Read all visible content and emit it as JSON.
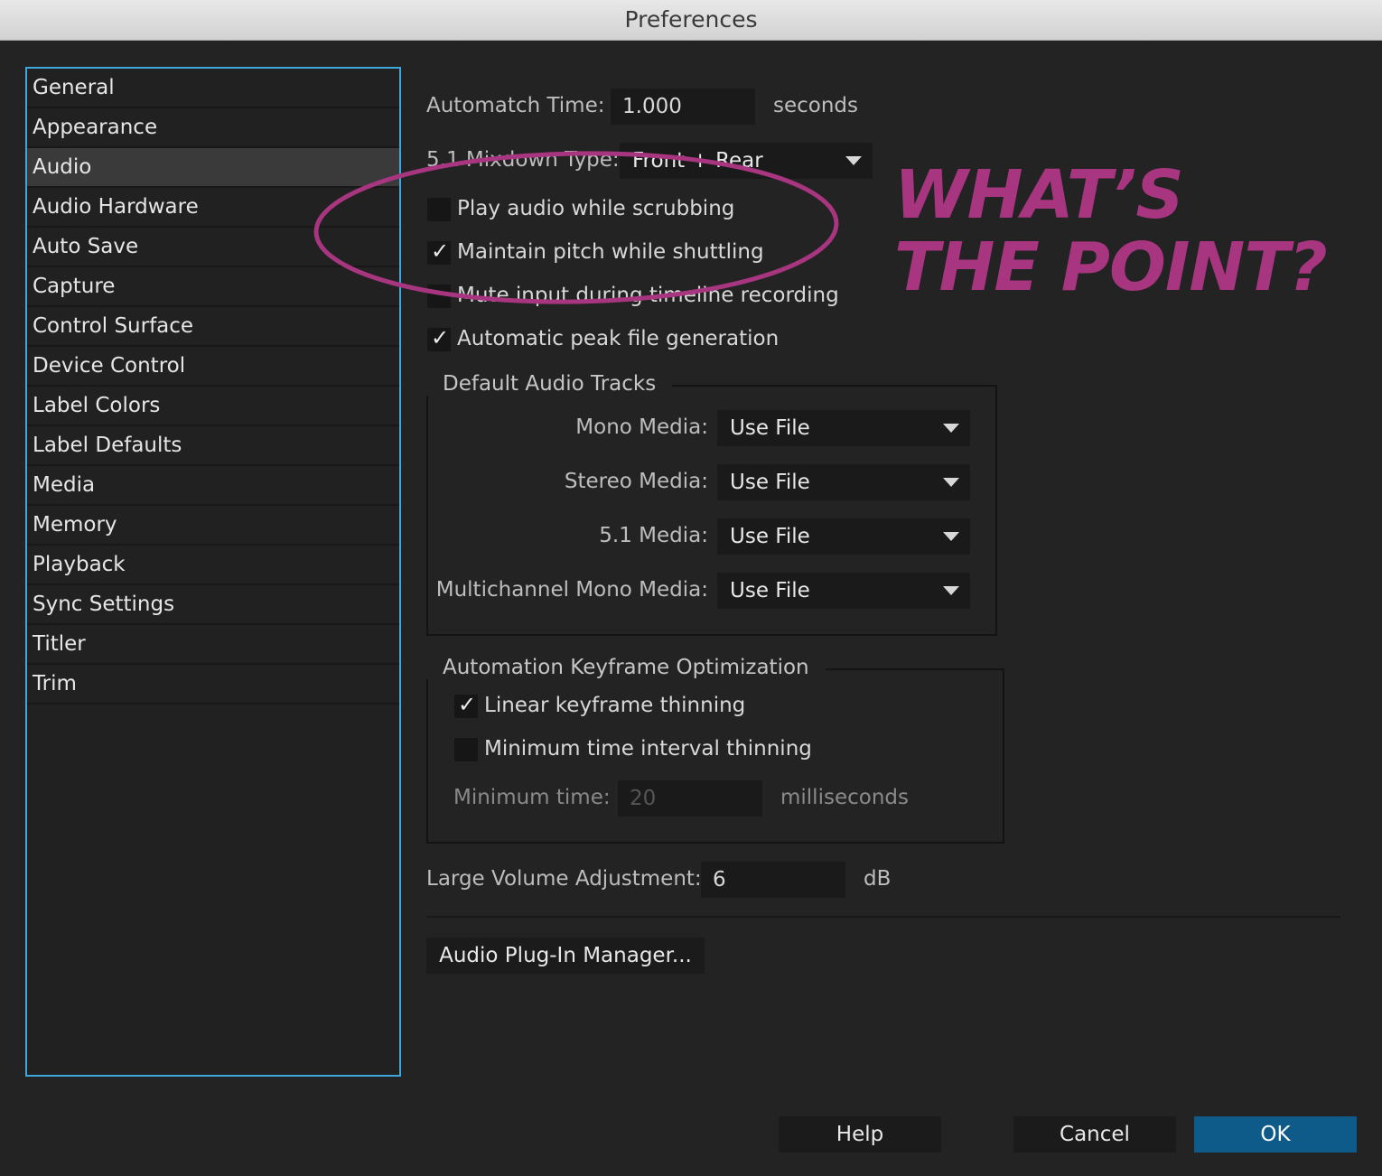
{
  "window": {
    "title": "Preferences"
  },
  "sidebar": {
    "items": [
      {
        "label": "General"
      },
      {
        "label": "Appearance"
      },
      {
        "label": "Audio"
      },
      {
        "label": "Audio Hardware"
      },
      {
        "label": "Auto Save"
      },
      {
        "label": "Capture"
      },
      {
        "label": "Control Surface"
      },
      {
        "label": "Device Control"
      },
      {
        "label": "Label Colors"
      },
      {
        "label": "Label Defaults"
      },
      {
        "label": "Media"
      },
      {
        "label": "Memory"
      },
      {
        "label": "Playback"
      },
      {
        "label": "Sync Settings"
      },
      {
        "label": "Titler"
      },
      {
        "label": "Trim"
      }
    ],
    "selected": "Audio"
  },
  "audio": {
    "automatch_label": "Automatch Time:",
    "automatch_value": "1.000",
    "automatch_unit": "seconds",
    "mixdown_label": "5.1 Mixdown Type:",
    "mixdown_value": "Front + Rear",
    "play_scrub_label": "Play audio while scrubbing",
    "play_scrub_checked": false,
    "maintain_pitch_label": "Maintain pitch while shuttling",
    "maintain_pitch_checked": true,
    "mute_input_label": "Mute input during timeline recording",
    "mute_input_checked": false,
    "auto_peak_label": "Automatic peak file generation",
    "auto_peak_checked": true
  },
  "default_tracks": {
    "legend": "Default Audio Tracks",
    "rows": [
      {
        "label": "Mono Media:",
        "value": "Use File"
      },
      {
        "label": "Stereo Media:",
        "value": "Use File"
      },
      {
        "label": "5.1 Media:",
        "value": "Use File"
      },
      {
        "label": "Multichannel Mono Media:",
        "value": "Use File"
      }
    ]
  },
  "keyframe_opt": {
    "legend": "Automation Keyframe Optimization",
    "linear_label": "Linear keyframe thinning",
    "linear_checked": true,
    "min_interval_label": "Minimum time interval thinning",
    "min_interval_checked": false,
    "min_time_label": "Minimum time:",
    "min_time_value": "20",
    "min_time_unit": "milliseconds"
  },
  "volume": {
    "label": "Large Volume Adjustment:",
    "value": "6",
    "unit": "dB"
  },
  "plugin_button": "Audio Plug-In Manager...",
  "footer": {
    "help": "Help",
    "cancel": "Cancel",
    "ok": "OK"
  },
  "annotation": {
    "line1": "WHAT’S",
    "line2": "THE POINT?",
    "color": "#a8357f"
  },
  "colors": {
    "accent": "#3fa6dc",
    "ok_button": "#0e5b8a"
  }
}
